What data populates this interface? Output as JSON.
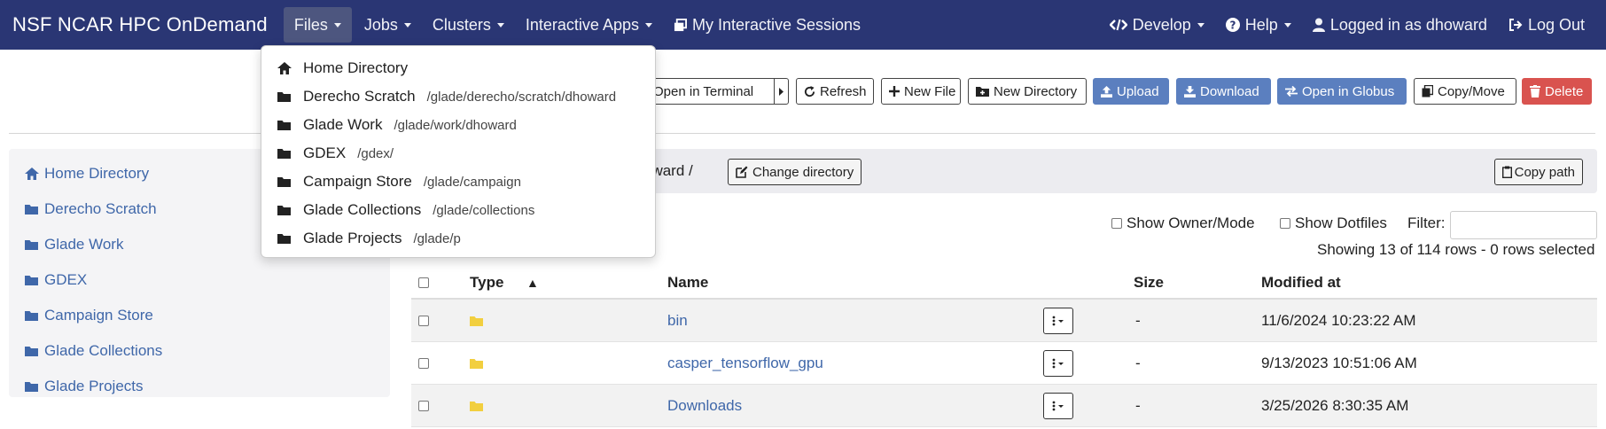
{
  "navbar": {
    "brand": "NSF NCAR HPC OnDemand",
    "menus": {
      "files": "Files",
      "jobs": "Jobs",
      "clusters": "Clusters",
      "interactive_apps": "Interactive Apps",
      "my_sessions": "My Interactive Sessions",
      "develop": "Develop",
      "help": "Help",
      "logged_in": "Logged in as dhoward",
      "logout": "Log Out"
    },
    "color": "#2a3674"
  },
  "files_dropdown": {
    "items": [
      {
        "label": "Home Directory",
        "path": "",
        "icon": "home-icon"
      },
      {
        "label": "Derecho Scratch",
        "path": "/glade/derecho/scratch/dhoward",
        "icon": "folder-icon"
      },
      {
        "label": "Glade Work",
        "path": "/glade/work/dhoward",
        "icon": "folder-icon"
      },
      {
        "label": "GDEX",
        "path": "/gdex/",
        "icon": "folder-icon"
      },
      {
        "label": "Campaign Store",
        "path": "/glade/campaign",
        "icon": "folder-icon"
      },
      {
        "label": "Glade Collections",
        "path": "/glade/collections",
        "icon": "folder-icon"
      },
      {
        "label": "Glade Projects",
        "path": "/glade/p",
        "icon": "folder-icon"
      }
    ]
  },
  "toolbar": {
    "open_terminal": "Open in Terminal",
    "refresh": "Refresh",
    "new_file": "New File",
    "new_directory": "New Directory",
    "upload": "Upload",
    "download": "Download",
    "open_globus": "Open in Globus",
    "copy_move": "Copy/Move",
    "delete": "Delete",
    "accent": "#5b7fbf",
    "danger": "#d9534f"
  },
  "sidebar": {
    "items": [
      {
        "label": "Home Directory",
        "icon": "home-icon"
      },
      {
        "label": "Derecho Scratch",
        "icon": "folder-icon"
      },
      {
        "label": "Glade Work",
        "icon": "folder-icon"
      },
      {
        "label": "GDEX",
        "icon": "folder-icon"
      },
      {
        "label": "Campaign Store",
        "icon": "folder-icon"
      },
      {
        "label": "Glade Collections",
        "icon": "folder-icon"
      },
      {
        "label": "Glade Projects",
        "icon": "folder-icon"
      }
    ]
  },
  "breadcrumb": {
    "visible_text": "oward /",
    "change_directory": "Change directory",
    "copy_path": "Copy path"
  },
  "filters": {
    "show_owner_mode": "Show Owner/Mode",
    "show_dotfiles": "Show Dotfiles",
    "filter_label": "Filter:",
    "showing": "Showing 13 of 114 rows - 0 rows selected"
  },
  "table": {
    "headers": {
      "type": "Type",
      "sort_indicator": "▲",
      "name": "Name",
      "size": "Size",
      "modified": "Modified at"
    },
    "rows": [
      {
        "name": "bin",
        "size": "-",
        "modified": "11/6/2024 10:23:22 AM"
      },
      {
        "name": "casper_tensorflow_gpu",
        "size": "-",
        "modified": "9/13/2023 10:51:06 AM"
      },
      {
        "name": "Downloads",
        "size": "-",
        "modified": "3/25/2026 8:30:35 AM"
      }
    ]
  }
}
